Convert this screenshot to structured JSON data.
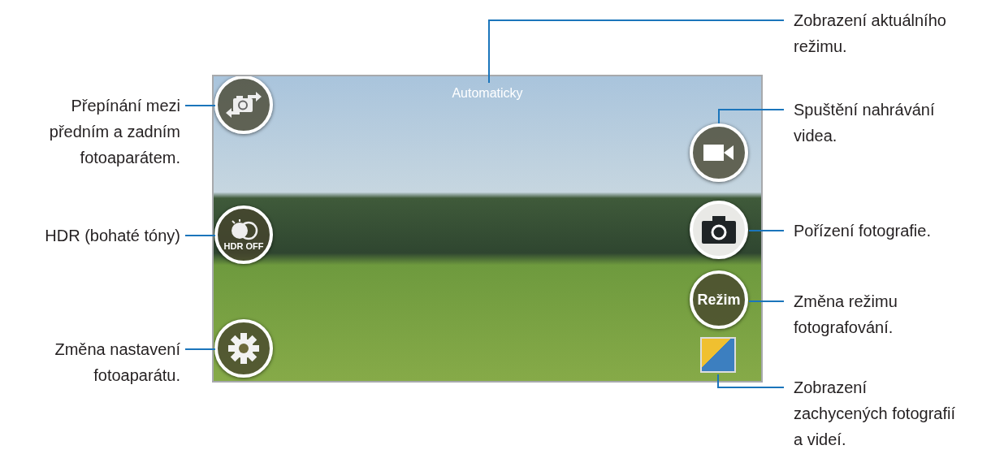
{
  "screen": {
    "mode_label": "Automaticky",
    "buttons": [
      {
        "kind": "switch-camera"
      },
      {
        "kind": "hdr",
        "label": "HDR OFF"
      },
      {
        "kind": "settings"
      },
      {
        "kind": "video"
      },
      {
        "kind": "shutter"
      },
      {
        "kind": "mode",
        "label": "Režim"
      },
      {
        "kind": "gallery"
      }
    ]
  },
  "left_callouts": [
    {
      "text": "Přepínání mezi\npředním a zadním\nfotoaparátem."
    },
    {
      "text": "HDR (bohaté tóny)"
    },
    {
      "text": "Změna nastavení\nfotoaparátu."
    }
  ],
  "right_callouts": [
    {
      "text": "Zobrazení aktuálního\nrežimu."
    },
    {
      "text": "Spuštění nahrávání\nvidea."
    },
    {
      "text": "Pořízení fotografie."
    },
    {
      "text": "Změna režimu\nfotografování."
    },
    {
      "text": "Zobrazení\nzachycených fotografií\na videí."
    }
  ]
}
